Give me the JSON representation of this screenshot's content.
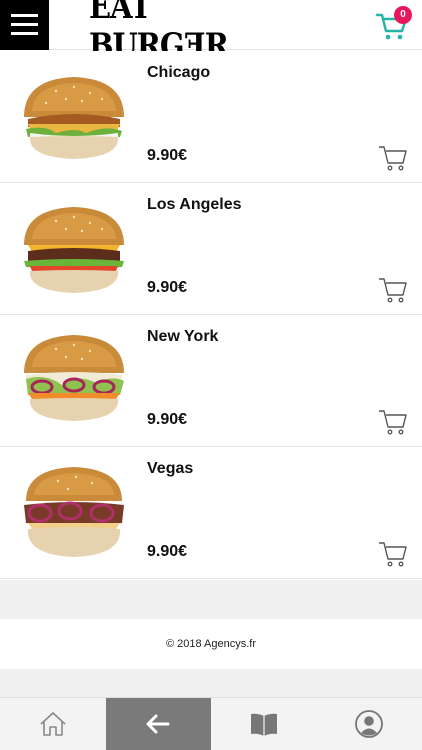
{
  "header": {
    "logo_text": "EAT BURGƎR",
    "cart_count": "0",
    "accent_color": "#26b3a6",
    "badge_color": "#e8175d"
  },
  "products": [
    {
      "name": "Chicago",
      "price": "9.90€"
    },
    {
      "name": "Los Angeles",
      "price": "9.90€"
    },
    {
      "name": "New York",
      "price": "9.90€"
    },
    {
      "name": "Vegas",
      "price": "9.90€"
    }
  ],
  "footer": {
    "copyright": "© 2018 Agencys.fr"
  },
  "bottom_nav": [
    {
      "icon": "home-icon"
    },
    {
      "icon": "back-arrow-icon",
      "active": true
    },
    {
      "icon": "book-icon"
    },
    {
      "icon": "user-icon"
    }
  ]
}
